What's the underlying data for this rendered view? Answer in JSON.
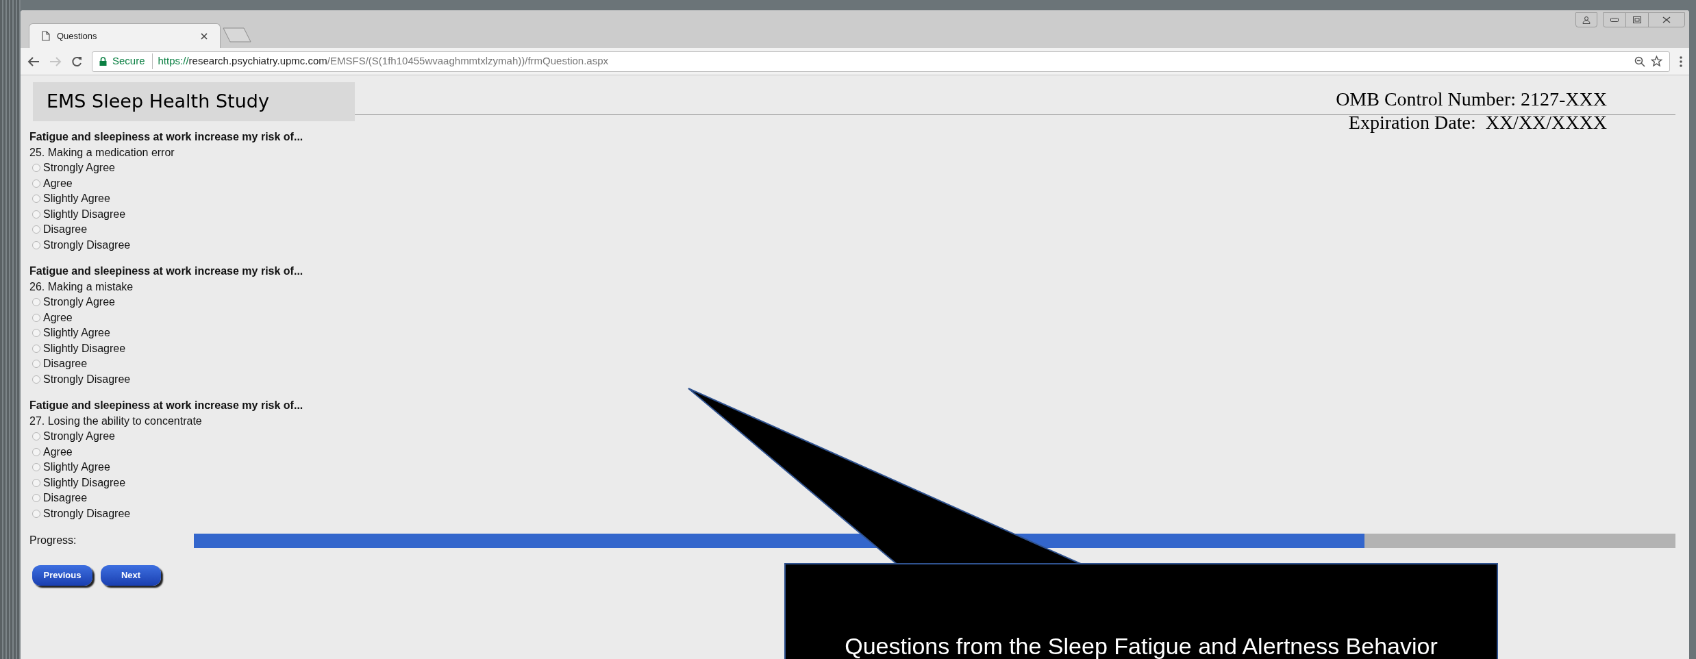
{
  "browser": {
    "tab": {
      "title": "Questions"
    },
    "address": {
      "secure_label": "Secure",
      "scheme": "https://",
      "host": "research.psychiatry.upmc.com",
      "path": "/EMSFS/(S(1fh10455wvaaghmmtxlzymah))/frmQuestion.aspx"
    }
  },
  "page": {
    "title": "EMS Sleep Health Study",
    "omb_lines": [
      "OMB Control Number: 2127-XXX",
      "Expiration Date:  XX/XX/XXXX"
    ]
  },
  "questions": [
    {
      "prompt": "Fatigue and sleepiness at work increase my risk of...",
      "item": "25. Making a medication error",
      "options": [
        {
          "label": "Strongly Agree",
          "selected": false
        },
        {
          "label": "Agree",
          "selected": false
        },
        {
          "label": "Slightly Agree",
          "selected": false
        },
        {
          "label": "Slightly Disagree",
          "selected": false
        },
        {
          "label": "Disagree",
          "selected": false
        },
        {
          "label": "Strongly Disagree",
          "selected": false
        }
      ]
    },
    {
      "prompt": "Fatigue and sleepiness at work increase my risk of...",
      "item": "26. Making a mistake",
      "options": [
        {
          "label": "Strongly Agree",
          "selected": false
        },
        {
          "label": "Agree",
          "selected": false
        },
        {
          "label": "Slightly Agree",
          "selected": false
        },
        {
          "label": "Slightly Disagree",
          "selected": false
        },
        {
          "label": "Disagree",
          "selected": false
        },
        {
          "label": "Strongly Disagree",
          "selected": false
        }
      ]
    },
    {
      "prompt": "Fatigue and sleepiness at work increase my risk of...",
      "item": "27. Losing the ability to concentrate",
      "options": [
        {
          "label": "Strongly Agree",
          "selected": false
        },
        {
          "label": "Agree",
          "selected": false
        },
        {
          "label": "Slightly Agree",
          "selected": false
        },
        {
          "label": "Slightly Disagree",
          "selected": false
        },
        {
          "label": "Disagree",
          "selected": false
        },
        {
          "label": "Strongly Disagree",
          "selected": false
        }
      ]
    }
  ],
  "progress": {
    "label": "Progress:",
    "level": 0.79
  },
  "buttons": [
    "Previous",
    "Next"
  ],
  "callout": {
    "text": "Questions from the Sleep Fatigue and Alertness Behavior"
  }
}
